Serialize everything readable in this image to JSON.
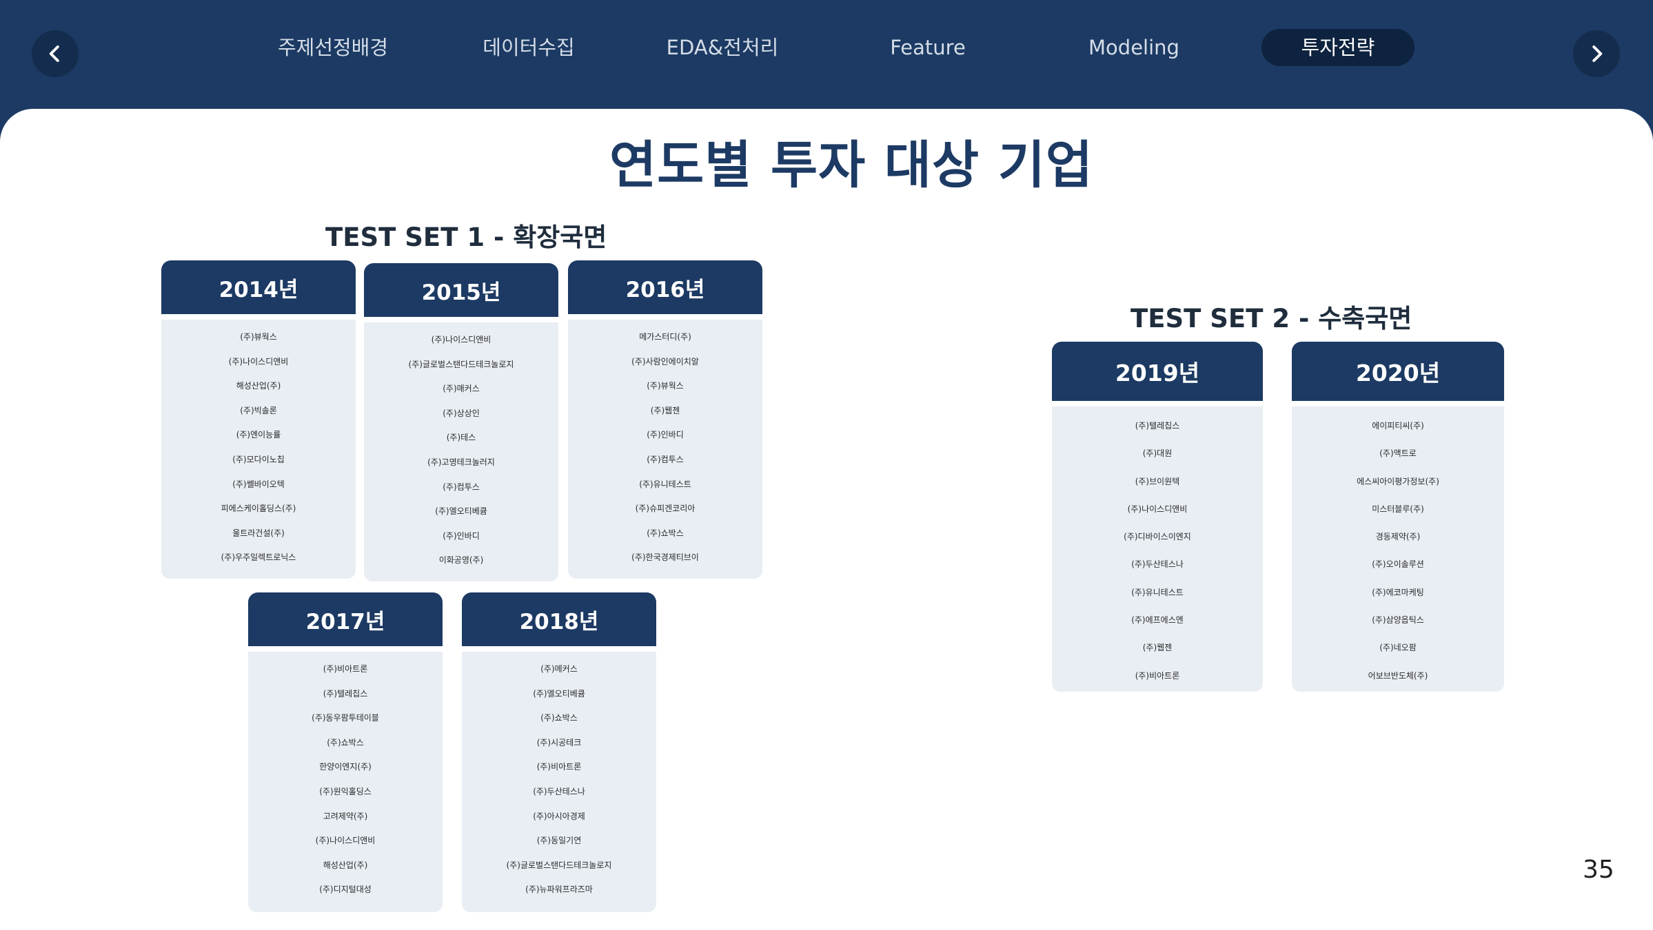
{
  "nav": {
    "prev_icon": "chevron-left-icon",
    "next_icon": "chevron-right-icon",
    "tabs": [
      {
        "label": "주제선정배경",
        "active": false
      },
      {
        "label": "데이터수집",
        "active": false
      },
      {
        "label": "EDA&전처리",
        "active": false
      },
      {
        "label": "Feature",
        "active": false
      },
      {
        "label": "Modeling",
        "active": false
      },
      {
        "label": "투자전략",
        "active": true
      }
    ]
  },
  "page": {
    "title": "연도별 투자 대상 기업",
    "number": "35"
  },
  "set1": {
    "title": "TEST SET 1 - 확장국면",
    "years": [
      {
        "year": "2014년",
        "companies": [
          "(주)뷰웍스",
          "(주)나이스디앤비",
          "해성산업(주)",
          "(주)빅솔론",
          "(주)엔이능률",
          "(주)모다이노칩",
          "(주)쎌바이오텍",
          "피에스케이홀딩스(주)",
          "울트라건설(주)",
          "(주)우주일렉트로닉스"
        ]
      },
      {
        "year": "2015년",
        "companies": [
          "(주)나이스디앤비",
          "(주)글로벌스탠다드테크놀로지",
          "(주)매커스",
          "(주)상상인",
          "(주)테스",
          "(주)고영테크놀러지",
          "(주)컴투스",
          "(주)엘오티베큠",
          "(주)인바디",
          "이화공영(주)"
        ]
      },
      {
        "year": "2016년",
        "companies": [
          "메가스터디(주)",
          "(주)사람인에이치알",
          "(주)뷰웍스",
          "(주)웹젠",
          "(주)인바디",
          "(주)컴투스",
          "(주)유니테스트",
          "(주)슈피겐코리아",
          "(주)쇼박스",
          "(주)한국경제티브이"
        ]
      },
      {
        "year": "2017년",
        "companies": [
          "(주)비아트론",
          "(주)텔레칩스",
          "(주)동우팜투테이블",
          "(주)쇼박스",
          "한양이엔지(주)",
          "(주)원익홀딩스",
          "고려제약(주)",
          "(주)나이스디앤비",
          "해성산업(주)",
          "(주)디지털대성"
        ]
      },
      {
        "year": "2018년",
        "companies": [
          "(주)메커스",
          "(주)엘오티베큠",
          "(주)쇼박스",
          "(주)시공테크",
          "(주)비아트론",
          "(주)두산테스나",
          "(주)아시아경제",
          "(주)동일기연",
          "(주)글로벌스탠다드테크놀로지",
          "(주)뉴파워프라즈마"
        ]
      }
    ]
  },
  "set2": {
    "title": "TEST SET 2 - 수축국면",
    "years": [
      {
        "year": "2019년",
        "companies": [
          "(주)텔레칩스",
          "(주)대원",
          "(주)브이원텍",
          "(주)나이스디앤비",
          "(주)디바이스이엔지",
          "(주)두산테스나",
          "(주)유니테스트",
          "(주)에프에스엔",
          "(주)웹젠",
          "(주)비아트론"
        ]
      },
      {
        "year": "2020년",
        "companies": [
          "에이피티씨(주)",
          "(주)액트로",
          "에스씨아이평가정보(주)",
          "미스터블루(주)",
          "경동제약(주)",
          "(주)오이솔루션",
          "(주)에코마케팅",
          "(주)삼양옵틱스",
          "(주)네오팜",
          "어보브반도체(주)"
        ]
      }
    ]
  }
}
